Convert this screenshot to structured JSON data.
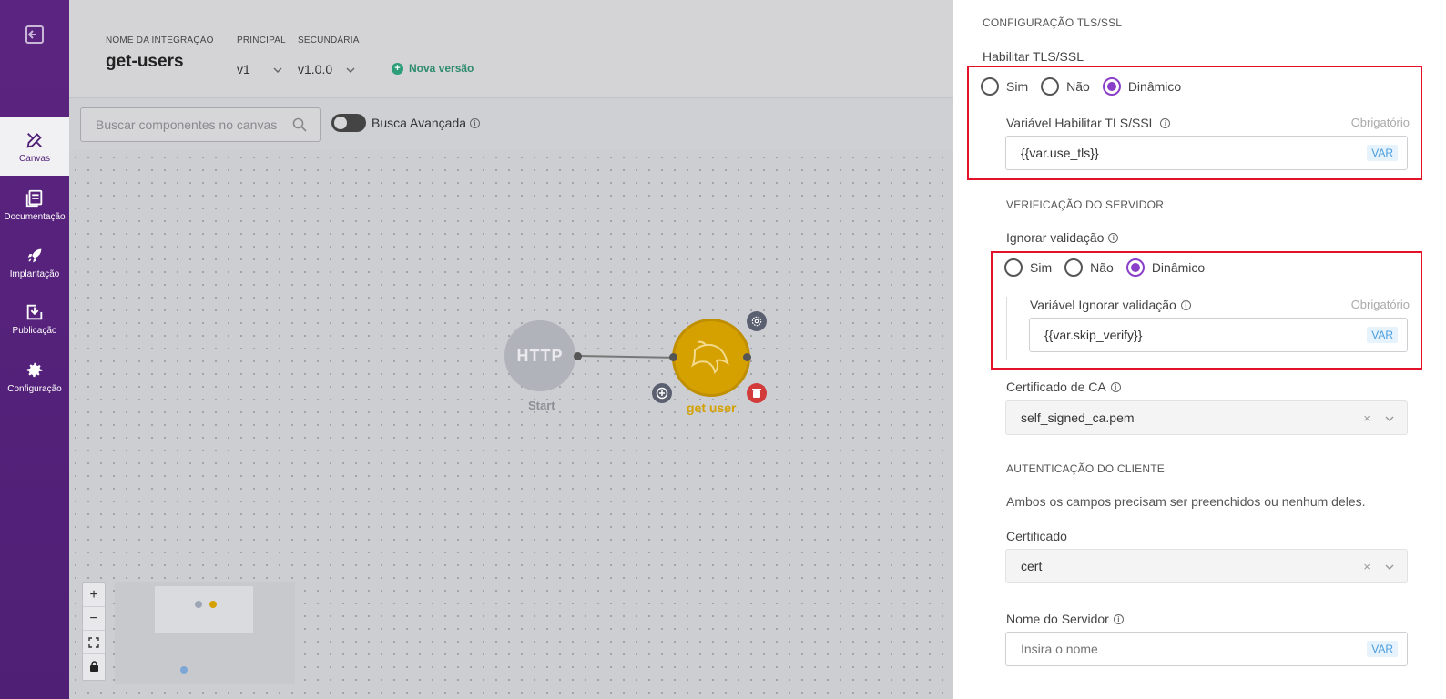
{
  "sidebar": {
    "items": [
      {
        "label": "Canvas",
        "icon": "canvas-icon",
        "active": true
      },
      {
        "label": "Documentação",
        "icon": "document-icon"
      },
      {
        "label": "Implantação",
        "icon": "rocket-icon"
      },
      {
        "label": "Publicação",
        "icon": "publish-icon"
      },
      {
        "label": "Configuração",
        "icon": "gear-icon"
      }
    ]
  },
  "header": {
    "name_label": "NOME DA INTEGRAÇÃO",
    "name": "get-users",
    "principal_label": "PRINCIPAL",
    "principal_value": "v1",
    "secundaria_label": "SECUNDÁRIA",
    "secundaria_value": "v1.0.0",
    "new_version": "Nova versão"
  },
  "search": {
    "placeholder": "Buscar componentes no canvas",
    "advanced_label": "Busca Avançada"
  },
  "canvas": {
    "http_node_text": "HTTP",
    "start_label": "Start",
    "db_node_label": "get user"
  },
  "panel": {
    "tls_section": "CONFIGURAÇÃO TLS/SSL",
    "tls_enable_label": "Habilitar TLS/SSL",
    "options": {
      "sim": "Sim",
      "nao": "Não",
      "dinamico": "Dinâmico"
    },
    "tls_var_label": "Variável Habilitar TLS/SSL",
    "required": "Obrigatório",
    "tls_var_value": "{{var.use_tls}}",
    "var_tag": "VAR",
    "server_section": "VERIFICAÇÃO DO SERVIDOR",
    "ignore_label": "Ignorar validação",
    "ignore_var_label": "Variável Ignorar validação",
    "ignore_var_value": "{{var.skip_verify}}",
    "ca_label": "Certificado de CA",
    "ca_value": "self_signed_ca.pem",
    "client_section": "AUTENTICAÇÃO DO CLIENTE",
    "client_note": "Ambos os campos precisam ser preenchidos ou nenhum deles.",
    "cert_label": "Certificado",
    "cert_value": "cert",
    "server_name_label": "Nome do Servidor",
    "server_name_placeholder": "Insira o nome",
    "accent_color": "#8a3fc8",
    "highlight_color": "#e3122a"
  }
}
